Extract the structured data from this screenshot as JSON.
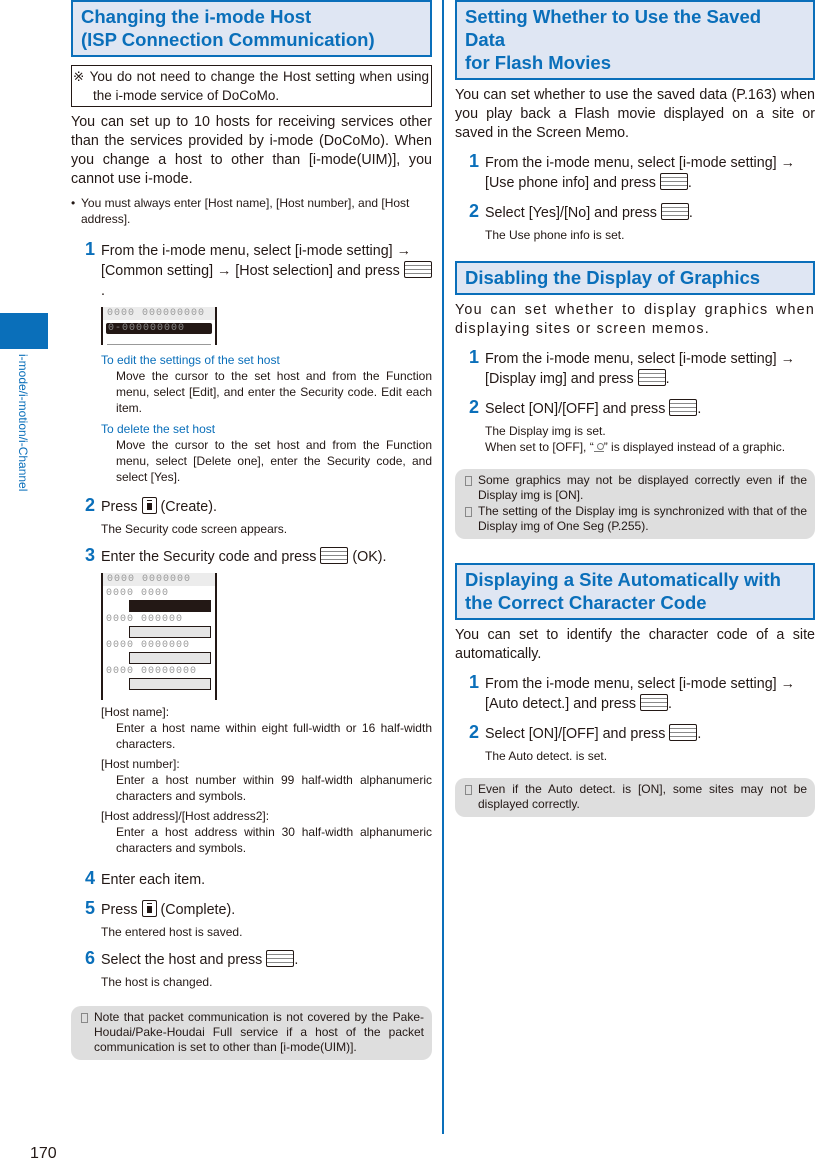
{
  "side": {
    "chapter_label": "i-mode/i-motion/i-Channel",
    "tab_color": "#0a6fba"
  },
  "page_number": "170",
  "left": {
    "title_line1": "Changing the i-mode Host",
    "title_line2": "(ISP Connection Communication)",
    "notice": "※ You do not need to change the Host setting when using the i-mode service of DoCoMo.",
    "intro": "You can set up to 10 hosts for receiving services other than the services provided by i-mode (DoCoMo). When you change a host to other than [i-mode(UIM)], you cannot use i-mode.",
    "bullet": "You must always enter [Host name], [Host number], and [Host address].",
    "steps": [
      {
        "num": "1",
        "text": "From the i-mode menu, select [i-mode setting] → [Common setting] → [Host selection] and press",
        "suffix": "."
      },
      {
        "num": "2",
        "text": "Press",
        "suffix": "(Create).",
        "sub": "The Security code screen appears."
      },
      {
        "num": "3",
        "text": "Enter the Security code and press",
        "suffix": "(OK)."
      },
      {
        "num": "4",
        "text": "Enter each item."
      },
      {
        "num": "5",
        "text": "Press",
        "suffix": "(Complete).",
        "sub": "The entered host is saved."
      },
      {
        "num": "6",
        "text": "Select the host and press",
        "suffix": ".",
        "sub": "The host is changed."
      }
    ],
    "screen1": {
      "header": "0000 000000000",
      "selected": "0-000000000"
    },
    "edit_head": "To edit the settings of the set host",
    "edit_body": "Move the cursor to the set host and from the Function menu, select [Edit], and enter the Security code. Edit each item.",
    "delete_head": "To delete the set host",
    "delete_body": "Move the cursor to the set host and from the Function menu, select [Delete one], enter the Security code, and select [Yes].",
    "screen2": {
      "header": "0000 0000000",
      "labels": [
        "0000 0000",
        "0000 000000",
        "0000 0000000",
        "0000 00000000"
      ]
    },
    "defs": [
      {
        "head": "[Host name]:",
        "body": "Enter a host name within eight full-width or 16 half-width characters."
      },
      {
        "head": "[Host number]:",
        "body": "Enter a host number within 99 half-width alphanumeric characters and symbols."
      },
      {
        "head": "[Host address]/[Host address2]:",
        "body": "Enter a host address within 30 half-width alphanumeric characters and symbols."
      }
    ],
    "note": "Note that packet communication is not covered by the Pake-Houdai/Pake-Houdai Full service if a host of the packet communication is set to other than [i-mode(UIM)]."
  },
  "right": {
    "s1": {
      "title_line1": "Setting Whether to Use the Saved Data",
      "title_line2": "for Flash Movies",
      "intro": "You can set whether to use the saved data (P.163) when you play back a Flash movie displayed on a site or saved in the Screen Memo.",
      "steps": [
        {
          "num": "1",
          "text": "From the i-mode menu, select [i-mode setting] → [Use phone info] and press",
          "suffix": "."
        },
        {
          "num": "2",
          "text": "Select [Yes]/[No] and press",
          "suffix": ".",
          "sub": "The Use phone info is set."
        }
      ]
    },
    "s2": {
      "title": "Disabling the Display of Graphics",
      "intro": "You can set whether to display graphics when displaying sites or screen memos.",
      "steps": [
        {
          "num": "1",
          "text": "From the i-mode menu, select [i-mode setting] → [Display img] and press",
          "suffix": "."
        },
        {
          "num": "2",
          "text": "Select [ON]/[OFF] and press",
          "suffix": ".",
          "sub": "The Display img is set.",
          "sub2_pre": "When set to [OFF], “",
          "sub2_post": "” is displayed instead of a graphic."
        }
      ],
      "notes": [
        "Some graphics may not be displayed correctly even if the Display img is [ON].",
        "The setting of the Display img is synchronized with that of the Display img of One Seg (P.255)."
      ]
    },
    "s3": {
      "title_line1": "Displaying a Site Automatically with",
      "title_line2": "the Correct Character Code",
      "intro": "You can set to identify the character code of a site automatically.",
      "steps": [
        {
          "num": "1",
          "text": "From the i-mode menu, select [i-mode setting] → [Auto detect.] and press",
          "suffix": "."
        },
        {
          "num": "2",
          "text": "Select [ON]/[OFF] and press",
          "suffix": ".",
          "sub": "The Auto detect. is set."
        }
      ],
      "notes": [
        "Even if the Auto detect. is [ON], some sites may not be displayed correctly."
      ]
    }
  }
}
